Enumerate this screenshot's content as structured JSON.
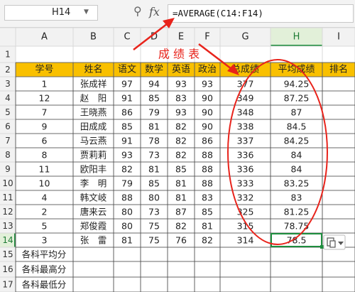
{
  "formula_bar": {
    "cell_ref": "H14",
    "zoom_icon": "zoom-icon",
    "fx_label": "fx",
    "formula": "=AVERAGE(C14:F14)"
  },
  "annotation": {
    "label": "成 绩 表"
  },
  "columns": [
    "A",
    "B",
    "C",
    "D",
    "E",
    "F",
    "G",
    "H",
    "I"
  ],
  "rows": [
    "1",
    "2",
    "3",
    "4",
    "5",
    "6",
    "7",
    "8",
    "9",
    "10",
    "11",
    "12",
    "13",
    "14",
    "15",
    "16",
    "17"
  ],
  "headers": [
    "学号",
    "姓名",
    "语文",
    "数学",
    "英语",
    "政治",
    "总成绩",
    "平均成绩",
    "排名"
  ],
  "students": [
    [
      "1",
      "张成祥",
      "97",
      "94",
      "93",
      "93",
      "377",
      "94.25"
    ],
    [
      "12",
      "赵　阳",
      "91",
      "85",
      "83",
      "90",
      "349",
      "87.25"
    ],
    [
      "7",
      "王晓燕",
      "86",
      "79",
      "93",
      "90",
      "348",
      "87"
    ],
    [
      "9",
      "田成成",
      "85",
      "81",
      "82",
      "90",
      "338",
      "84.5"
    ],
    [
      "6",
      "马云燕",
      "91",
      "78",
      "82",
      "86",
      "337",
      "84.25"
    ],
    [
      "8",
      "贾莉莉",
      "93",
      "73",
      "82",
      "88",
      "336",
      "84"
    ],
    [
      "11",
      "欧阳丰",
      "82",
      "81",
      "85",
      "88",
      "336",
      "84"
    ],
    [
      "10",
      "李　明",
      "79",
      "85",
      "81",
      "88",
      "333",
      "83.25"
    ],
    [
      "4",
      "韩文岐",
      "88",
      "80",
      "81",
      "83",
      "332",
      "83"
    ],
    [
      "2",
      "唐来云",
      "80",
      "73",
      "87",
      "85",
      "325",
      "81.25"
    ],
    [
      "5",
      "郑俊霞",
      "80",
      "75",
      "82",
      "81",
      "315",
      "78.75"
    ],
    [
      "3",
      "张　雷",
      "81",
      "75",
      "76",
      "82",
      "314",
      "78.5"
    ]
  ],
  "summary_labels": [
    "各科平均分",
    "各科最高分",
    "各科最低分"
  ],
  "colors": {
    "header_fill": "#f9c000",
    "selection": "#1e8e3e",
    "annotation": "#e8231b",
    "col_header_selected": "#e2f0d9",
    "col_header_text_selected": "#1e7b34"
  },
  "paste_options_icon": "paste-options-icon"
}
